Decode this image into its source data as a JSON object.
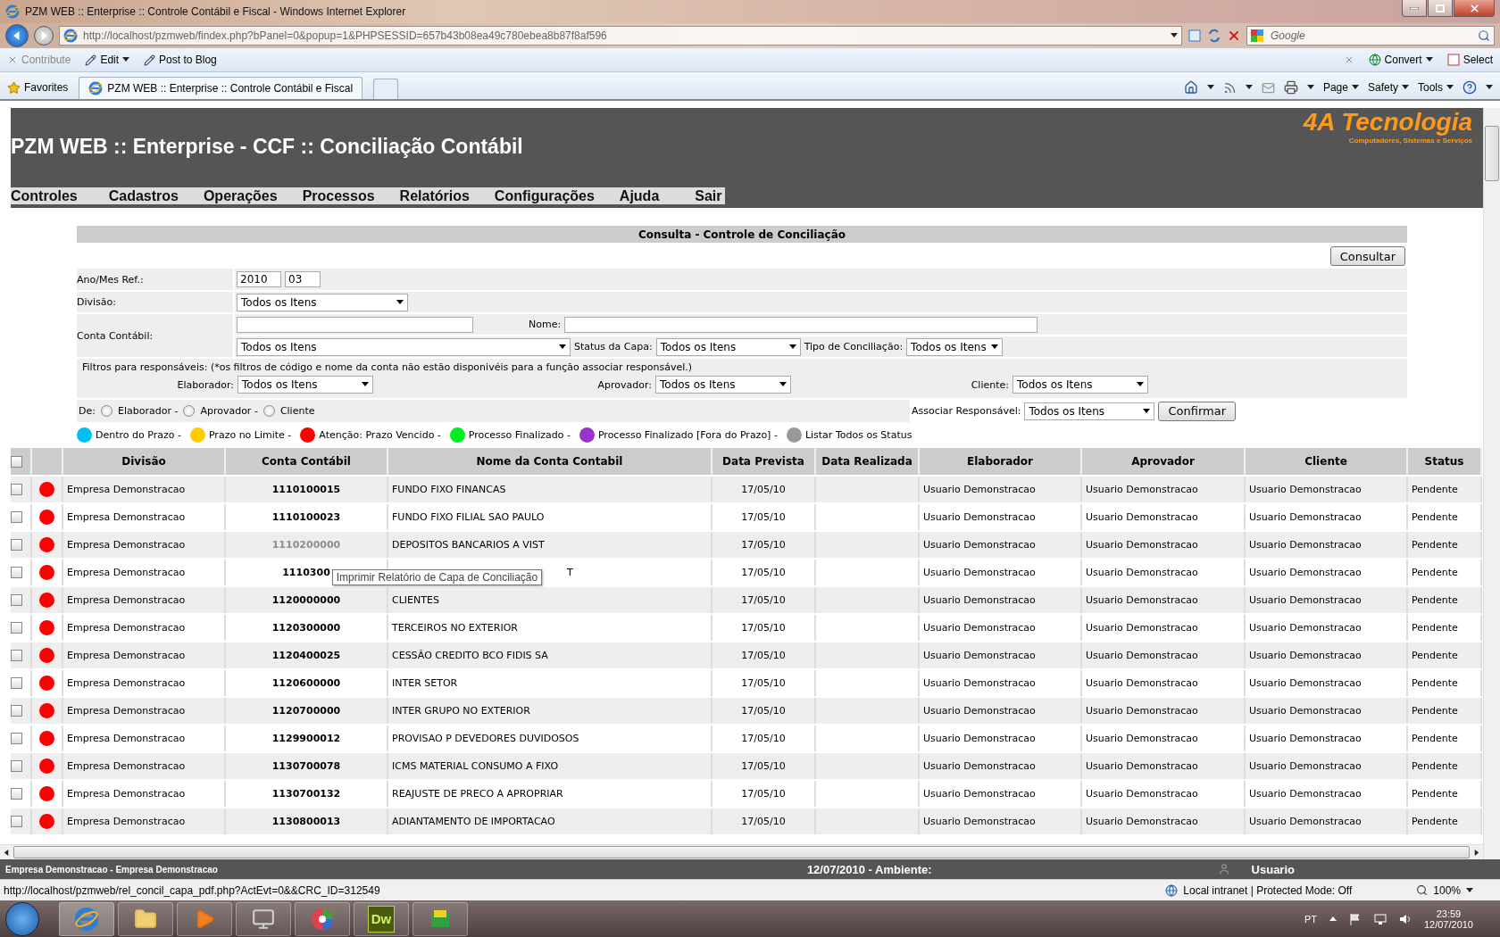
{
  "window": {
    "title": "PZM WEB :: Enterprise :: Controle Contábil e Fiscal - Windows Internet Explorer"
  },
  "address_bar": {
    "url": "http://localhost/pzmweb/findex.php?bPanel=0&popup=1&PHPSESSID=657b43b08ea49c780ebea8b87f8af596",
    "search_placeholder": "Google"
  },
  "command_bar": {
    "left": [
      {
        "label": "Contribute",
        "disabled": true
      },
      {
        "label": "Edit",
        "disabled": false
      },
      {
        "label": "Post to Blog",
        "disabled": false
      }
    ],
    "right": [
      "Convert",
      "Select"
    ]
  },
  "favorites_bar": {
    "favorites": "Favorites",
    "tab": "PZM WEB :: Enterprise :: Controle Contábil e Fiscal",
    "menus": [
      "Page",
      "Safety",
      "Tools"
    ]
  },
  "header": {
    "title": "PZM WEB :: Enterprise - CCF :: Conciliação Contábil",
    "logo": "4A Tecnologia",
    "logo_tagline": "Computadores, Sistemas e Serviços"
  },
  "menu": [
    "Controles",
    "Cadastros",
    "Operações",
    "Processos",
    "Relatórios",
    "Configurações",
    "Ajuda",
    "Sair"
  ],
  "panel_title": "Consulta - Controle de Conciliação",
  "consult_button": "Consultar",
  "form": {
    "ano_mes": {
      "label": "Ano/Mes Ref.:",
      "year": "2010",
      "month": "03"
    },
    "divisao": {
      "label": "Divisão:",
      "value": "Todos os Itens"
    },
    "conta": {
      "label": "Conta Contábil:",
      "nome_label": "Nome:",
      "value": "Todos os Itens",
      "status_label": "Status da Capa:",
      "status_value": "Todos os Itens",
      "tipo_label": "Tipo de Conciliação:",
      "tipo_value": "Todos os Itens"
    },
    "filtros_note": "Filtros para responsáveis: (*os filtros de código e nome da conta não estão disponivéis para a função associar responsável.)",
    "responsaveis": [
      {
        "label": "Elaborador:",
        "value": "Todos os Itens"
      },
      {
        "label": "Aprovador:",
        "value": "Todos os Itens"
      },
      {
        "label": "Cliente:",
        "value": "Todos os Itens"
      }
    ],
    "de_label": "De:",
    "de_options": [
      {
        "label": "Elaborador -",
        "selected": false
      },
      {
        "label": "Aprovador -",
        "selected": false
      },
      {
        "label": "Cliente",
        "selected": false
      }
    ],
    "associar_label": "Associar Responsável:",
    "associar_value": "Todos os Itens",
    "confirm_button": "Confirmar"
  },
  "legend": [
    {
      "label": "Dentro do Prazo -",
      "color": "#00c0f0"
    },
    {
      "label": "Prazo no Limite -",
      "color": "#ffcc00"
    },
    {
      "label": "Atenção: Prazo Vencido -",
      "color": "#ff0000"
    },
    {
      "label": "Processo Finalizado -",
      "color": "#00ee22"
    },
    {
      "label": "Processo Finalizado [Fora do Prazo] -",
      "color": "#9933cc"
    },
    {
      "label": "Listar Todos os Status",
      "color": "#999999"
    }
  ],
  "table": {
    "header_checked": false,
    "columns": [
      "Divisão",
      "Conta Contábil",
      "Nome da Conta Contabil",
      "Data Prevista",
      "Data Realizada",
      "Elaborador",
      "Aprovador",
      "Cliente",
      "Status"
    ],
    "rows": [
      {
        "checked": false,
        "color": "#ff0000",
        "divisao": "Empresa Demonstracao",
        "conta": "1110100015",
        "nome": "FUNDO FIXO FINANCAS",
        "prevista": "17/05/10",
        "elaborador": "Usuario Demonstracao",
        "aprovador": "Usuario Demonstracao",
        "cliente": "Usuario Demonstracao",
        "status": "Pendente"
      },
      {
        "checked": false,
        "color": "#ff0000",
        "divisao": "Empresa Demonstracao",
        "conta": "1110100023",
        "nome": "FUNDO FIXO FILIAL SAO PAULO",
        "prevista": "17/05/10",
        "elaborador": "Usuario Demonstracao",
        "aprovador": "Usuario Demonstracao",
        "cliente": "Usuario Demonstracao",
        "status": "Pendente"
      },
      {
        "checked": false,
        "color": "#ff0000",
        "divisao": "Empresa Demonstracao",
        "conta": "1110200000",
        "hovered": true,
        "nome": "DEPOSITOS BANCARIOS A VIST",
        "prevista": "17/05/10",
        "elaborador": "Usuario Demonstracao",
        "aprovador": "Usuario Demonstracao",
        "cliente": "Usuario Demonstracao",
        "status": "Pendente"
      },
      {
        "checked": false,
        "color": "#ff0000",
        "divisao": "Empresa Demonstracao",
        "conta": "1110300",
        "tooltip": "Imprimir Relatório de Capa de Conciliação",
        "nome": "T",
        "prevista": "17/05/10",
        "elaborador": "Usuario Demonstracao",
        "aprovador": "Usuario Demonstracao",
        "cliente": "Usuario Demonstracao",
        "status": "Pendente"
      },
      {
        "checked": false,
        "color": "#ff0000",
        "divisao": "Empresa Demonstracao",
        "conta": "1120000000",
        "nome": "CLIENTES",
        "prevista": "17/05/10",
        "elaborador": "Usuario Demonstracao",
        "aprovador": "Usuario Demonstracao",
        "cliente": "Usuario Demonstracao",
        "status": "Pendente"
      },
      {
        "checked": false,
        "color": "#ff0000",
        "divisao": "Empresa Demonstracao",
        "conta": "1120300000",
        "nome": "TERCEIROS NO EXTERIOR",
        "prevista": "17/05/10",
        "elaborador": "Usuario Demonstracao",
        "aprovador": "Usuario Demonstracao",
        "cliente": "Usuario Demonstracao",
        "status": "Pendente"
      },
      {
        "checked": false,
        "color": "#ff0000",
        "divisao": "Empresa Demonstracao",
        "conta": "1120400025",
        "nome": "CESSÃO CREDITO BCO FIDIS SA",
        "prevista": "17/05/10",
        "elaborador": "Usuario Demonstracao",
        "aprovador": "Usuario Demonstracao",
        "cliente": "Usuario Demonstracao",
        "status": "Pendente"
      },
      {
        "checked": false,
        "color": "#ff0000",
        "divisao": "Empresa Demonstracao",
        "conta": "1120600000",
        "nome": "INTER SETOR",
        "prevista": "17/05/10",
        "elaborador": "Usuario Demonstracao",
        "aprovador": "Usuario Demonstracao",
        "cliente": "Usuario Demonstracao",
        "status": "Pendente"
      },
      {
        "checked": false,
        "color": "#ff0000",
        "divisao": "Empresa Demonstracao",
        "conta": "1120700000",
        "nome": "INTER GRUPO NO EXTERIOR",
        "prevista": "17/05/10",
        "elaborador": "Usuario Demonstracao",
        "aprovador": "Usuario Demonstracao",
        "cliente": "Usuario Demonstracao",
        "status": "Pendente"
      },
      {
        "checked": false,
        "color": "#ff0000",
        "divisao": "Empresa Demonstracao",
        "conta": "1129900012",
        "nome": "PROVISAO P DEVEDORES DUVIDOSOS",
        "prevista": "17/05/10",
        "elaborador": "Usuario Demonstracao",
        "aprovador": "Usuario Demonstracao",
        "cliente": "Usuario Demonstracao",
        "status": "Pendente"
      },
      {
        "checked": false,
        "color": "#ff0000",
        "divisao": "Empresa Demonstracao",
        "conta": "1130700078",
        "nome": "ICMS MATERIAL CONSUMO A FIXO",
        "prevista": "17/05/10",
        "elaborador": "Usuario Demonstracao",
        "aprovador": "Usuario Demonstracao",
        "cliente": "Usuario Demonstracao",
        "status": "Pendente"
      },
      {
        "checked": false,
        "color": "#ff0000",
        "divisao": "Empresa Demonstracao",
        "conta": "1130700132",
        "nome": "REAJUSTE DE PRECO A APROPRIAR",
        "prevista": "17/05/10",
        "elaborador": "Usuario Demonstracao",
        "aprovador": "Usuario Demonstracao",
        "cliente": "Usuario Demonstracao",
        "status": "Pendente"
      },
      {
        "checked": false,
        "color": "#ff0000",
        "divisao": "Empresa Demonstracao",
        "conta": "1130800013",
        "nome": "ADIANTAMENTO DE IMPORTACAO",
        "prevista": "17/05/10",
        "elaborador": "Usuario Demonstracao",
        "aprovador": "Usuario Demonstracao",
        "cliente": "Usuario Demonstracao",
        "status": "Pendente"
      }
    ]
  },
  "footer": {
    "company": "Empresa Demonstracao - Empresa Demonstracao",
    "date_env": "12/07/2010 - Ambiente:",
    "user": "Usuario"
  },
  "status_bar": {
    "url": "http://localhost/pzmweb/rel_concil_capa_pdf.php?ActEvt=0&&CRC_ID=312549",
    "zone": "Local intranet | Protected Mode: Off",
    "zoom": "100%"
  },
  "taskbar": {
    "dw_label": "Dw",
    "language": "PT",
    "time": "23:59",
    "date": "12/07/2010"
  }
}
